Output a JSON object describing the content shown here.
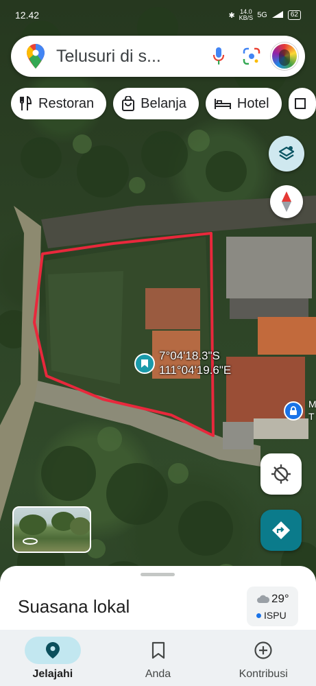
{
  "status_bar": {
    "time": "12.42",
    "net_speed_value": "14.0",
    "net_speed_unit": "KB/S",
    "signal": "5G",
    "battery": "62"
  },
  "search": {
    "placeholder": "Telusuri di s...",
    "mic_icon": "mic-icon",
    "lens_icon": "lens-icon"
  },
  "chips": [
    {
      "label": "Restoran",
      "icon": "fork-knife-icon"
    },
    {
      "label": "Belanja",
      "icon": "shopping-bag-icon"
    },
    {
      "label": "Hotel",
      "icon": "bed-icon"
    }
  ],
  "map": {
    "coord_lat": "7°04'18.3\"S",
    "coord_lng": "111°04'19.6\"E",
    "place_label_1": "M",
    "place_label_2": "T",
    "outline_color": "#e8283c"
  },
  "sheet": {
    "title": "Suasana lokal",
    "temperature": "29°",
    "air_quality": "ISPU"
  },
  "nav": {
    "items": [
      {
        "label": "Jelajahi",
        "icon": "location-pin-icon",
        "active": true
      },
      {
        "label": "Anda",
        "icon": "bookmark-icon",
        "active": false
      },
      {
        "label": "Kontribusi",
        "icon": "add-circle-icon",
        "active": false
      }
    ]
  }
}
